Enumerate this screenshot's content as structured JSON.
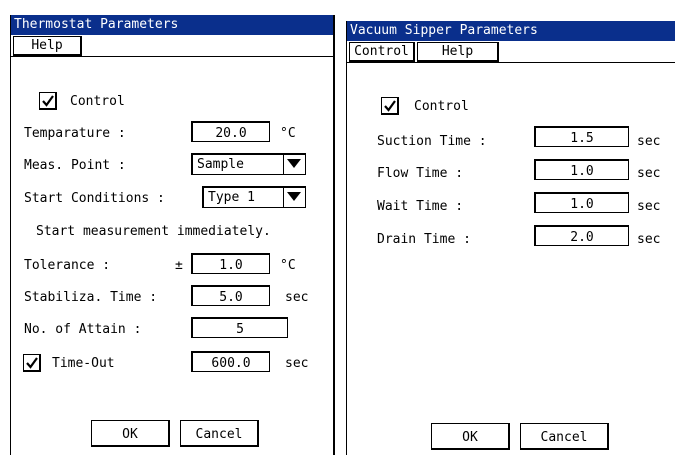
{
  "colors": {
    "titlebar": "#0a2f8c",
    "titlebar_text": "#ffffff"
  },
  "thermostat": {
    "title": "Thermostat Parameters",
    "menu": [
      "Help"
    ],
    "control_label": "Control",
    "control_checked": true,
    "temperature": {
      "label": "Temparature :",
      "value": "20.0",
      "unit": "°C"
    },
    "meas_point": {
      "label": "Meas. Point :",
      "value": "Sample"
    },
    "start_conditions": {
      "label": "Start Conditions :",
      "value": "Type 1"
    },
    "start_message": "Start measurement immediately.",
    "tolerance": {
      "label": "Tolerance :",
      "prefix": "±",
      "value": "1.0",
      "unit": "°C"
    },
    "stabiliza_time": {
      "label": "Stabiliza. Time :",
      "value": "5.0",
      "unit": "sec"
    },
    "no_of_attain": {
      "label": "No. of Attain :",
      "value": "5"
    },
    "time_out": {
      "label": "Time-Out",
      "checked": true,
      "value": "600.0",
      "unit": "sec"
    },
    "ok_label": "OK",
    "cancel_label": "Cancel"
  },
  "vacuum": {
    "title": "Vacuum Sipper Parameters",
    "menu": [
      "Control",
      "Help"
    ],
    "control_label": "Control",
    "control_checked": true,
    "suction_time": {
      "label": "Suction Time :",
      "value": "1.5",
      "unit": "sec"
    },
    "flow_time": {
      "label": "Flow Time :",
      "value": "1.0",
      "unit": "sec"
    },
    "wait_time": {
      "label": "Wait Time :",
      "value": "1.0",
      "unit": "sec"
    },
    "drain_time": {
      "label": "Drain Time :",
      "value": "2.0",
      "unit": "sec"
    },
    "ok_label": "OK",
    "cancel_label": "Cancel"
  }
}
